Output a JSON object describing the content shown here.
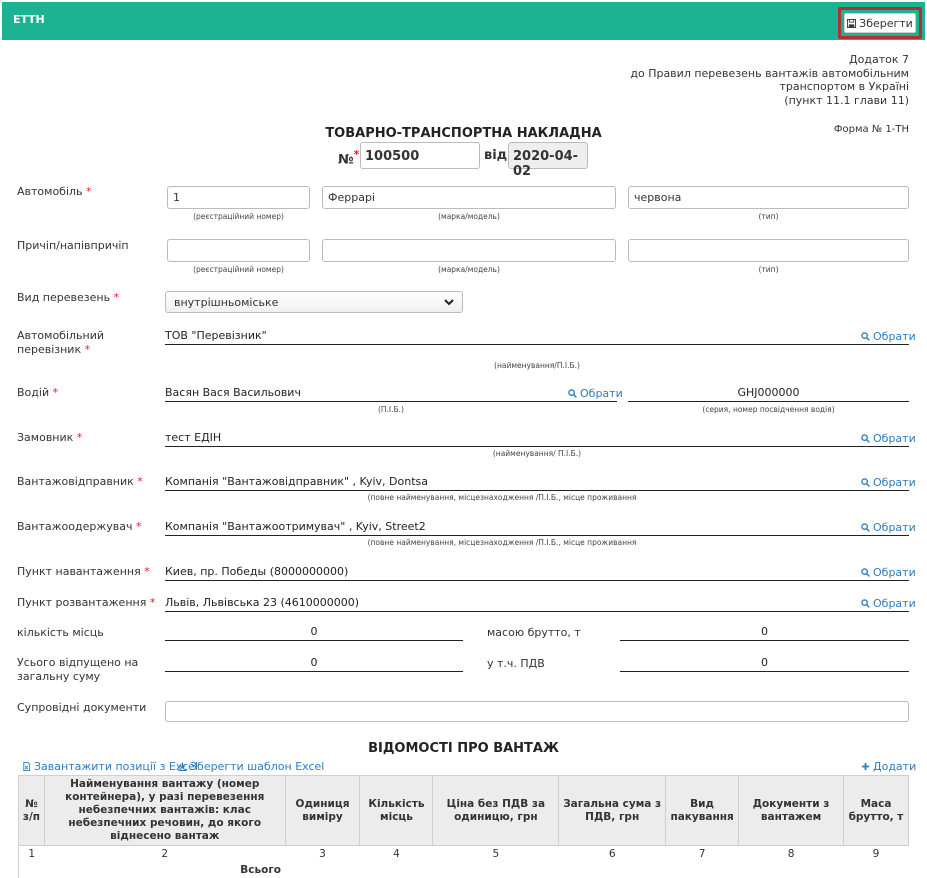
{
  "header": {
    "title": "ЕТТН",
    "save_label": "Зберегти"
  },
  "note": {
    "line1": "Додаток 7",
    "line2": "до Правил перевезень вантажів автомобільним",
    "line3": "транспортом в Україні",
    "line4": "(пункт 11.1 глави 11)"
  },
  "document": {
    "title": "ТОВАРНО-ТРАНСПОРТНА НАКЛАДНА",
    "form_no": "Форма № 1-ТН",
    "number_label": "№",
    "number_value": "100500",
    "date_label": "від",
    "date_value": "2020-04-02"
  },
  "required_mark": "*",
  "vehicle": {
    "label": "Автомобіль",
    "reg_no": "1",
    "brand": "Феррарі",
    "type": "червона",
    "hint_reg": "(реєстраційний номер)",
    "hint_brand": "(марка/модель)",
    "hint_type": "(тип)"
  },
  "trailer": {
    "label": "Причіп/напівпричіп",
    "reg_no": "",
    "brand": "",
    "type": "",
    "hint_reg": "(реєстраційний номер)",
    "hint_brand": "(марка/модель)",
    "hint_type": "(тип)"
  },
  "transport_kind": {
    "label": "Вид перевезень",
    "value": "внутрішньоміське"
  },
  "carrier": {
    "label": "Автомобільний перевізник",
    "value": "ТОВ \"Перевізник\"",
    "hint": "(найменування/П.І.Б.)"
  },
  "driver": {
    "label": "Водій",
    "value": "Васян Вася Васильович",
    "hint": "(П.І.Б.)",
    "license": "GHJ000000",
    "license_hint": "(серия, номер посвідчення водія)"
  },
  "customer": {
    "label": "Замовник",
    "value": "тест ЕДІН",
    "hint": "(найменування/ П.І.Б.)"
  },
  "shipper": {
    "label": "Вантажовідправник",
    "value": "Компанія \"Вантажовідправник\" , Kyiv, Dontsa",
    "hint": "(повне найменування, місцезнаходження /П.І.Б., місце проживання"
  },
  "consignee": {
    "label": "Вантажоодержувач",
    "value": "Компанія \"Вантажоотримувач\" , Kyiv, Street2",
    "hint": "(повне найменування, місцезнаходження /П.І.Б., місце проживання"
  },
  "loading_point": {
    "label": "Пункт навантаження",
    "value": "Киев, пр. Победы (8000000000)"
  },
  "unloading_point": {
    "label": "Пункт розвантаження",
    "value": "Львів, Львівська 23 (4610000000)"
  },
  "totals": {
    "places_label": "кількість місць",
    "places_value": "0",
    "gross_label": "масою брутто, т",
    "gross_value": "0",
    "sum_label": "Усього відпущено на загальну суму",
    "sum_value": "0",
    "vat_label": "у т.ч. ПДВ",
    "vat_value": "0"
  },
  "docs": {
    "label": "Супровідні документи",
    "value": ""
  },
  "select_link": "Обрати",
  "goods": {
    "title": "ВІДОМОСТІ ПРО ВАНТАЖ",
    "upload_link": "Завантажити позиції з Excel",
    "template_link": "Зберегти шаблон Excel",
    "add_link": "Додати",
    "columns": [
      "№ з/п",
      "Найменування вантажу (номер контейнера), у разі перевезення небезпечних вантажів: клас небезпечних речовин, до якого віднесено вантаж",
      "Одиниця виміру",
      "Кількість місць",
      "Ціна без ПДВ за одиницю, грн",
      "Загальна сума з ПДВ, грн",
      "Вид пакування",
      "Документи з вантажем",
      "Маса брутто, т"
    ],
    "numbers": [
      "1",
      "2",
      "3",
      "4",
      "5",
      "6",
      "7",
      "8",
      "9"
    ],
    "total_label": "Всього"
  }
}
